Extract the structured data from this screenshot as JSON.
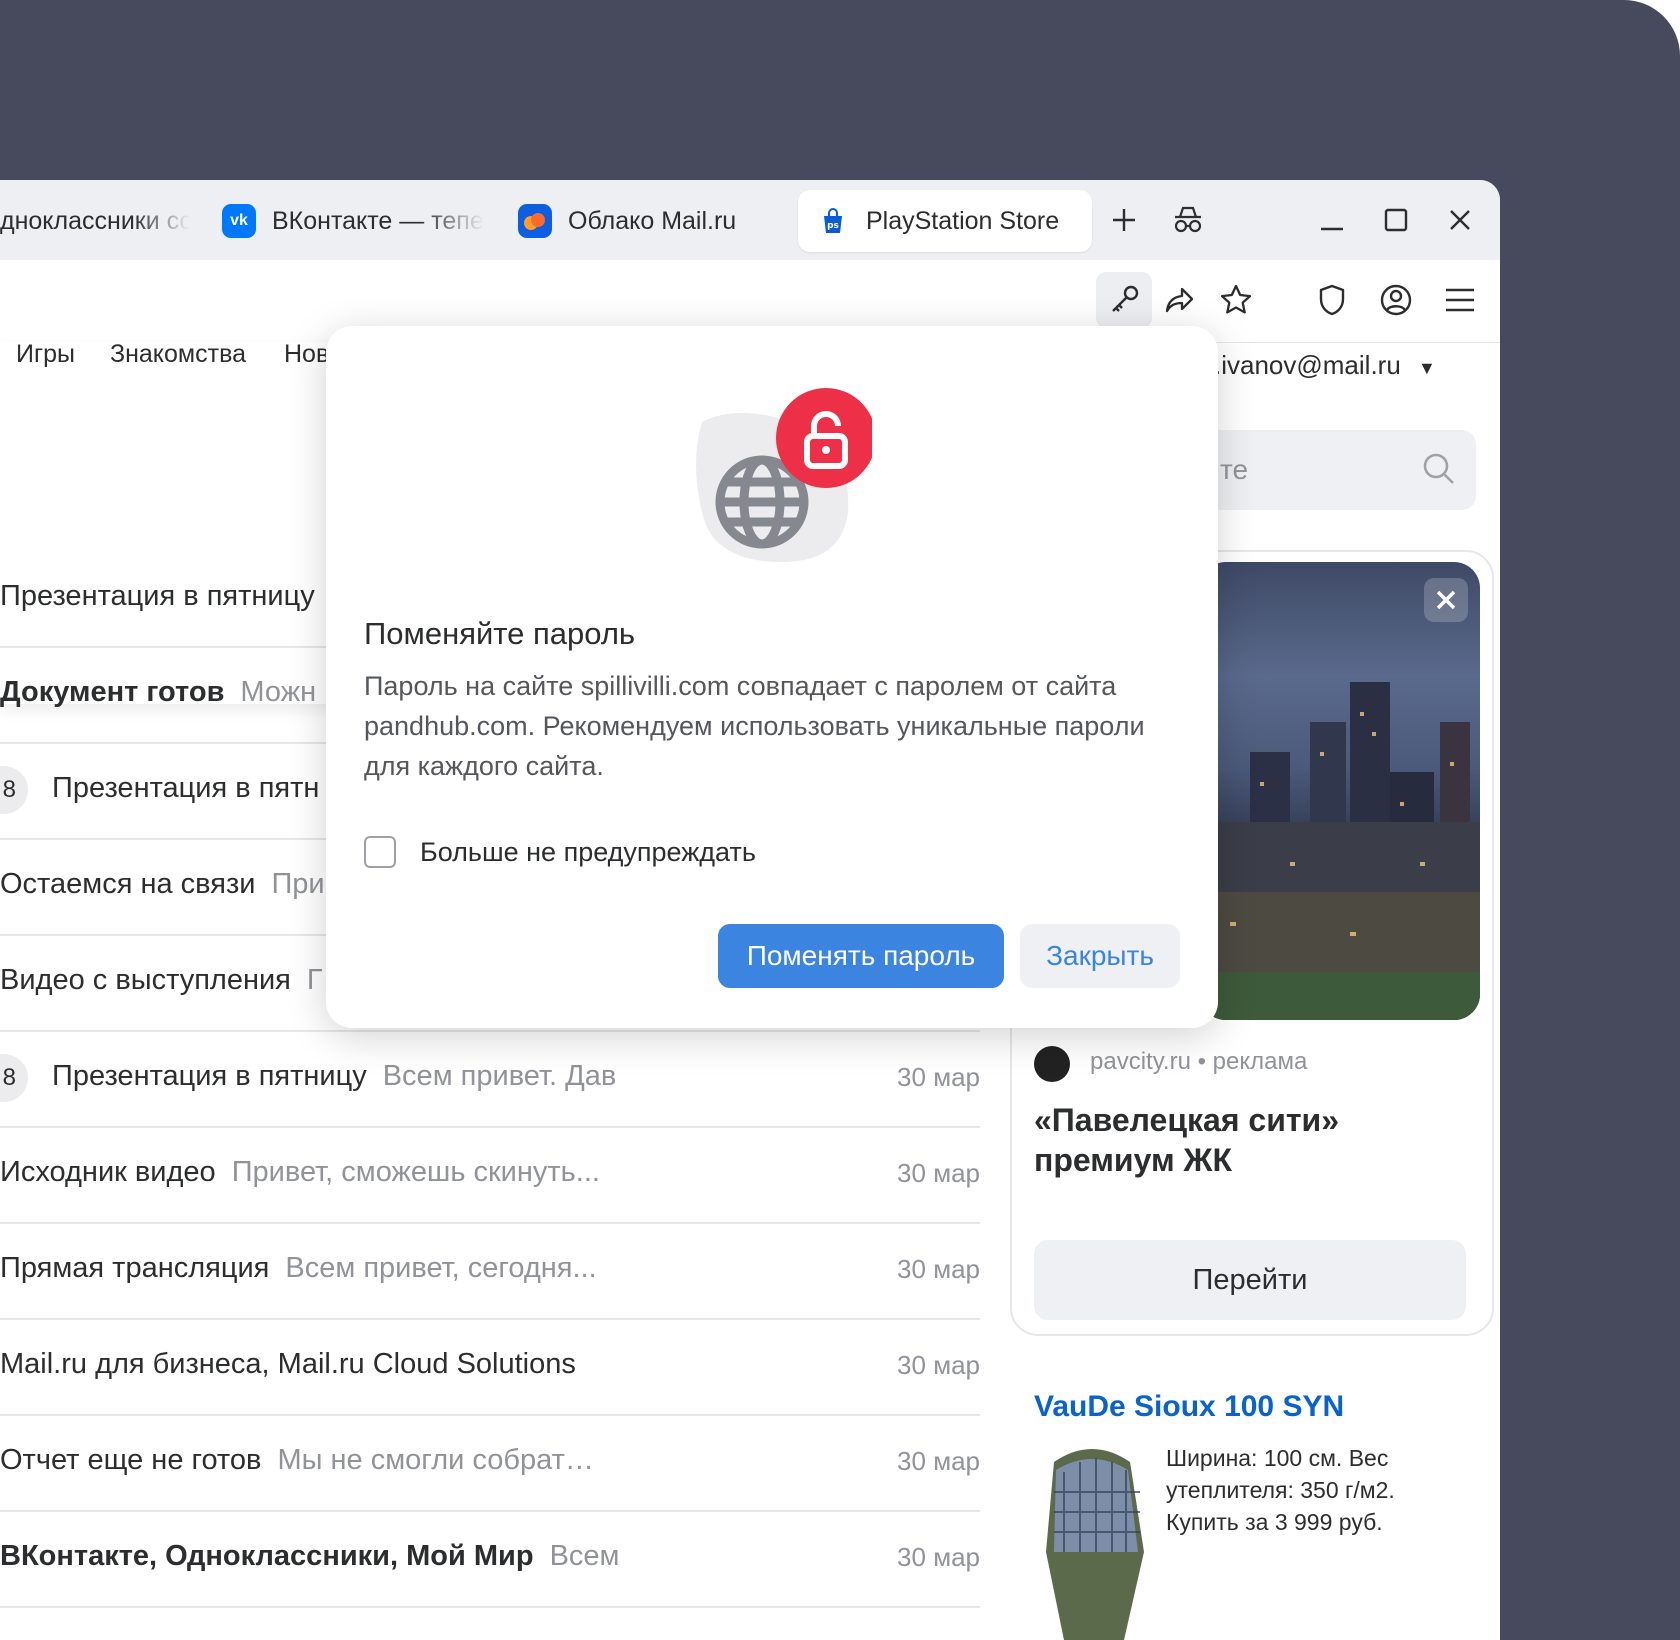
{
  "browser": {
    "tabs": [
      {
        "title": "дноклассники со",
        "active": false
      },
      {
        "title": "ВКонтакте — тепер",
        "active": false
      },
      {
        "title": "Облако Mail.ru",
        "active": false
      },
      {
        "title": "PlayStation Store",
        "active": true
      }
    ],
    "vk_icon_text": "vk"
  },
  "site": {
    "nav": [
      "Игры",
      "Знакомства",
      "Нов"
    ],
    "account": ".ivanov@mail.ru",
    "search_placeholder": "те"
  },
  "mail_list": [
    {
      "subject": "Презентация в пятницу",
      "preview": "",
      "date": "",
      "bold": false,
      "count": ""
    },
    {
      "subject": "Документ готов",
      "preview": "Можн",
      "date": "",
      "bold": true,
      "count": ""
    },
    {
      "subject": "Презентация в пятн",
      "preview": "",
      "date": "",
      "bold": false,
      "count": "8"
    },
    {
      "subject": "Остаемся на связи",
      "preview": "При",
      "date": "",
      "bold": false,
      "count": ""
    },
    {
      "subject": "Видео с выступления",
      "preview": "Г",
      "date": "",
      "bold": false,
      "count": ""
    },
    {
      "subject": "Презентация в пятницу",
      "preview": "Всем привет. Дав",
      "date": "30 мар",
      "bold": false,
      "count": "8"
    },
    {
      "subject": "Исходник видео",
      "preview": "Привет, сможешь скинуть...",
      "date": "30 мар",
      "bold": false,
      "count": ""
    },
    {
      "subject": "Прямая трансляция",
      "preview": "Всем привет, сегодня...",
      "date": "30 мар",
      "bold": false,
      "count": ""
    },
    {
      "subject": "Mail.ru для бизнеса, Mail.ru Cloud Solutions",
      "preview": "",
      "date": "30 мар",
      "bold": false,
      "count": ""
    },
    {
      "subject": "Отчет еще не готов",
      "preview": "Мы не смогли собрат…",
      "date": "30 мар",
      "bold": false,
      "count": ""
    },
    {
      "subject": "ВКонтакте, Одноклассники, Мой Мир",
      "preview": "Всем",
      "date": "30 мар",
      "bold": true,
      "count": ""
    }
  ],
  "ad1": {
    "source": "pavcity.ru • реклама",
    "title": "«Павелецкая сити» премиум ЖК",
    "button": "Перейти"
  },
  "ad2": {
    "title": "VauDe Sioux 100 SYN",
    "text": "Ширина: 100 см. Вес утеплителя: 350 г/м2. Купить за 3 999 руб."
  },
  "dialog": {
    "title": "Поменяйте пароль",
    "text": "Пароль на сайте spillivilli.com совпадает с паролем от сайта pandhub.com. Рекомендуем использовать уникальные пароли для каждого сайта.",
    "checkbox_label": "Больше не предупреждать",
    "primary_button": "Поменять пароль",
    "secondary_button": "Закрыть"
  },
  "colors": {
    "accent": "#3b84e0",
    "alert": "#ed2f47",
    "frame": "#464a5c",
    "link": "#0a62cc"
  }
}
